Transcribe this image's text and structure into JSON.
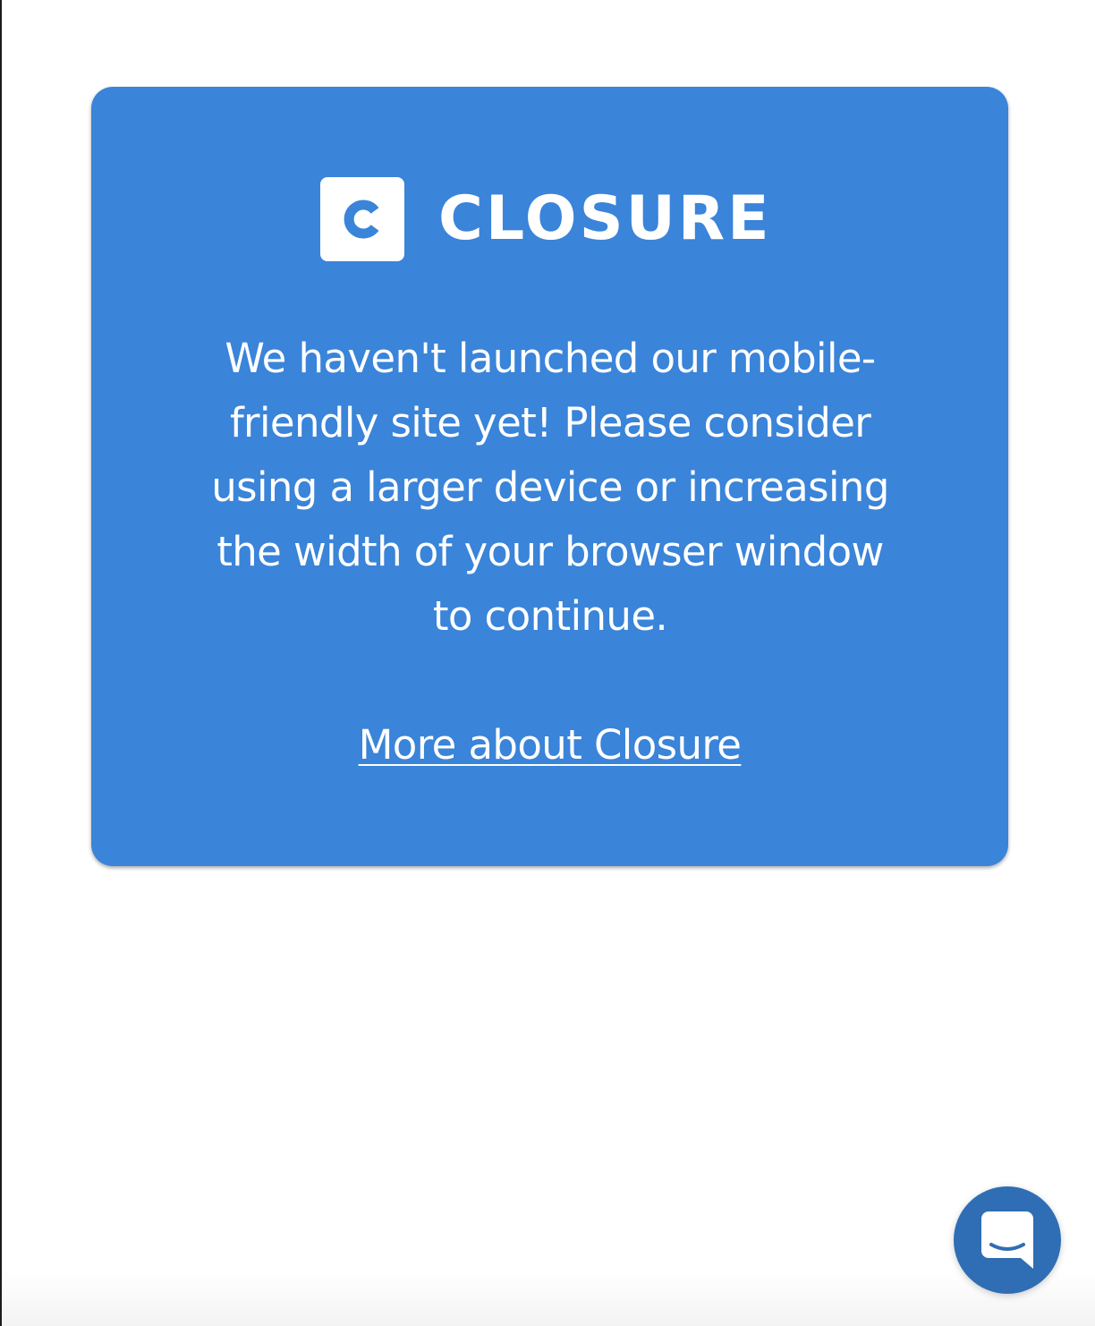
{
  "brand": {
    "name": "CLOSURE",
    "mark_letter": "C",
    "logo_icon": "closure-c-logo-icon",
    "color": "#3a84d9"
  },
  "notice": {
    "message": "We haven't launched our mobile-friendly site yet! Please consider using a larger device or increasing the width of your browser window to continue.",
    "link_label": "More about Closure"
  },
  "chat": {
    "icon": "chat-bubble-icon",
    "color": "#2f6eb4"
  }
}
